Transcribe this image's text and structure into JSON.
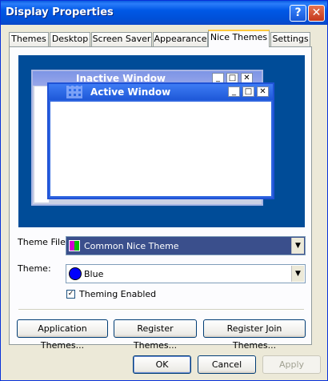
{
  "window": {
    "title": "Display Properties",
    "help_symbol": "?",
    "close_symbol": "✕"
  },
  "tabs": [
    {
      "label": "Themes"
    },
    {
      "label": "Desktop"
    },
    {
      "label": "Screen Saver"
    },
    {
      "label": "Appearance"
    },
    {
      "label": "Nice Themes"
    },
    {
      "label": "Settings"
    }
  ],
  "active_tab": "Nice Themes",
  "preview": {
    "inactive_title": "Inactive Window",
    "active_title": "Active Window",
    "btn_minimize": "_",
    "btn_maximize": "□",
    "btn_close": "✕"
  },
  "theme_file": {
    "label": "Theme File:",
    "value": "Common Nice Theme"
  },
  "theme": {
    "label": "Theme:",
    "value": "Blue",
    "swatch_color": "#0000ff"
  },
  "theming": {
    "label": "Theming Enabled",
    "checked": true,
    "check_mark": "✓"
  },
  "buttons": {
    "application_themes": "Application Themes...",
    "register_themes": "Register Themes...",
    "register_join_themes": "Register Join Themes..."
  },
  "dialog_buttons": {
    "ok": "OK",
    "cancel": "Cancel",
    "apply": "Apply"
  },
  "colors": {
    "title_bar": "#0054e3",
    "preview_bg": "#004c98",
    "dialog_bg": "#ece9d8"
  },
  "combo_arrow": "▼"
}
